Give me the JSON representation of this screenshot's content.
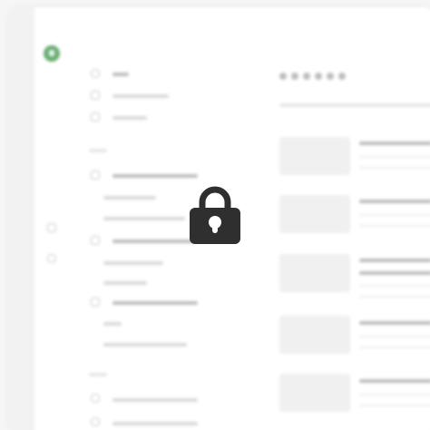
{
  "overlay": {
    "locked": true,
    "icon": "lock-icon"
  },
  "colors": {
    "accent": "#67ad72",
    "lock": "#2f2f2f",
    "background": "#f6f6f6"
  },
  "sidebar": {
    "icons": [
      "logo-icon",
      "home-icon",
      "document-icon",
      "rocket-icon",
      "bolt-icon",
      "search-icon",
      "gear-icon",
      "user-icon"
    ]
  },
  "content": {
    "pagination_dots": 6,
    "cards": 5
  }
}
